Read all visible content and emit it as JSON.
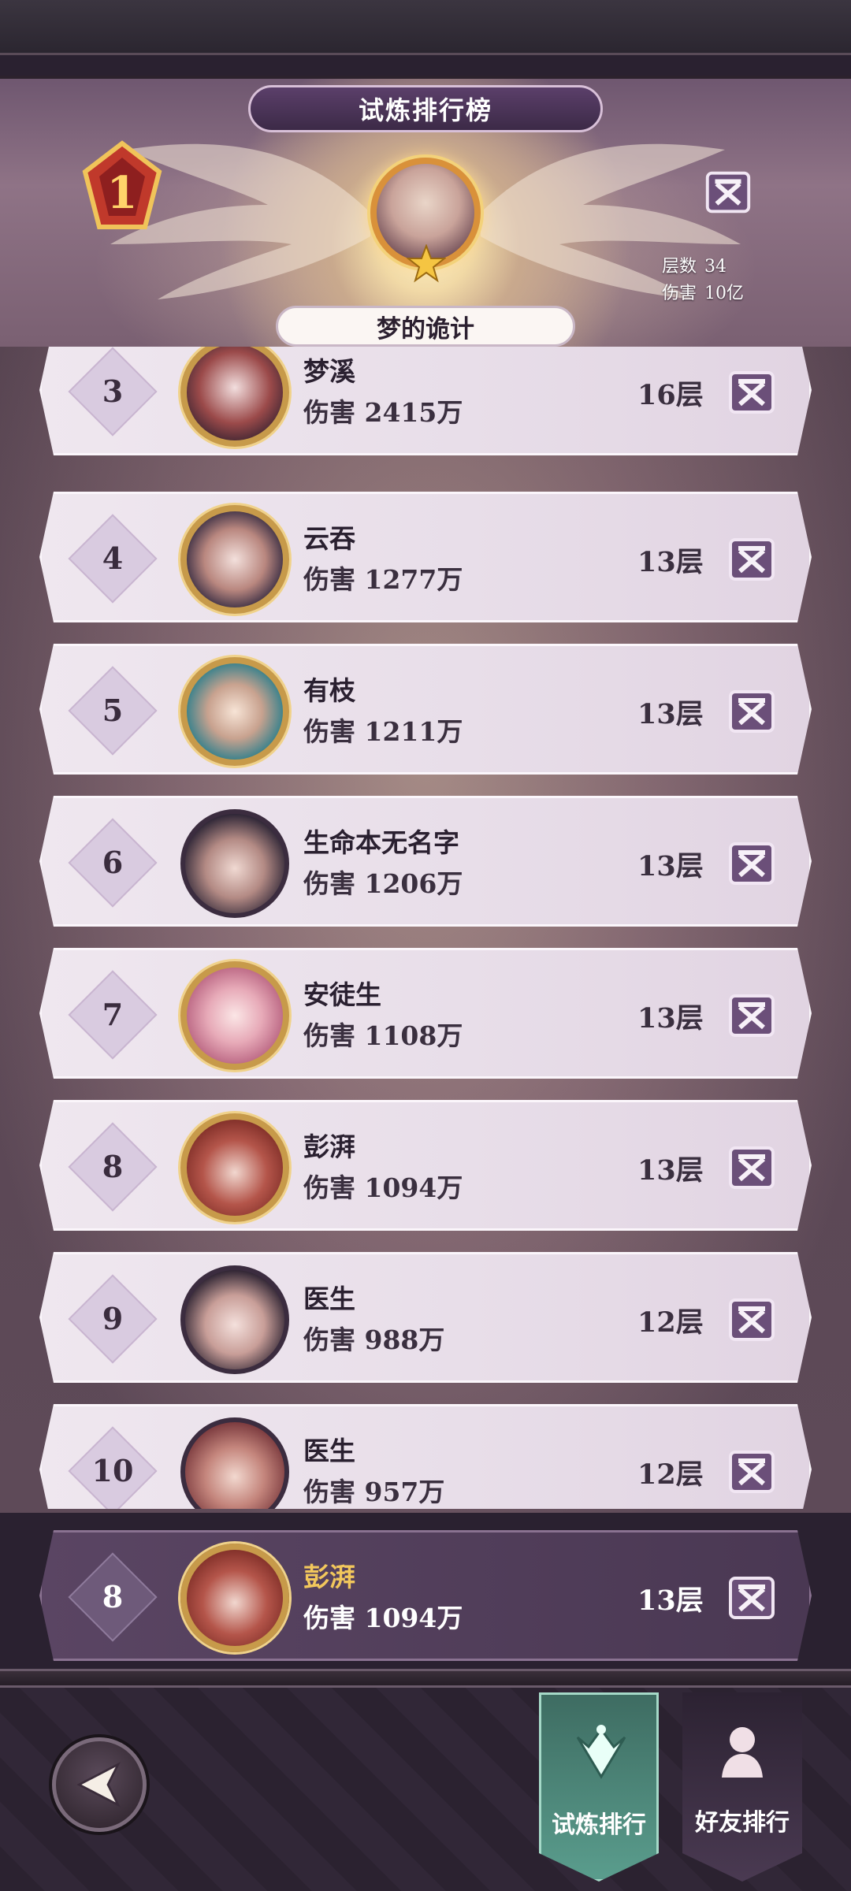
{
  "header": {
    "title": "试炼排行榜"
  },
  "champion": {
    "rank": "1",
    "name": "梦的诡计",
    "stats": [
      {
        "label": "层数",
        "value": "34"
      },
      {
        "label": "伤害",
        "value": "10亿"
      }
    ]
  },
  "rows": [
    {
      "rank": "3",
      "name": "梦溪",
      "damage": "伤害 2415万",
      "floors": "16层"
    },
    {
      "rank": "4",
      "name": "云吞",
      "damage": "伤害 1277万",
      "floors": "13层"
    },
    {
      "rank": "5",
      "name": "有枝",
      "damage": "伤害 1211万",
      "floors": "13层"
    },
    {
      "rank": "6",
      "name": "生命本无名字",
      "damage": "伤害 1206万",
      "floors": "13层"
    },
    {
      "rank": "7",
      "name": "安徒生",
      "damage": "伤害 1108万",
      "floors": "13层"
    },
    {
      "rank": "8",
      "name": "彭湃",
      "damage": "伤害 1094万",
      "floors": "13层"
    },
    {
      "rank": "9",
      "name": "医生",
      "damage": "伤害 988万",
      "floors": "12层"
    },
    {
      "rank": "10",
      "name": "医生",
      "damage": "伤害 957万",
      "floors": "12层"
    }
  ],
  "self_row": {
    "rank": "8",
    "name": "彭湃",
    "damage": "伤害 1094万",
    "floors": "13层"
  },
  "tabs": {
    "trial": "试炼排行",
    "friends": "好友排行"
  },
  "colors": {
    "accent_gold": "#f2c75c",
    "active_tab": "#4f8a7c",
    "panel_dark": "#4a3853"
  }
}
